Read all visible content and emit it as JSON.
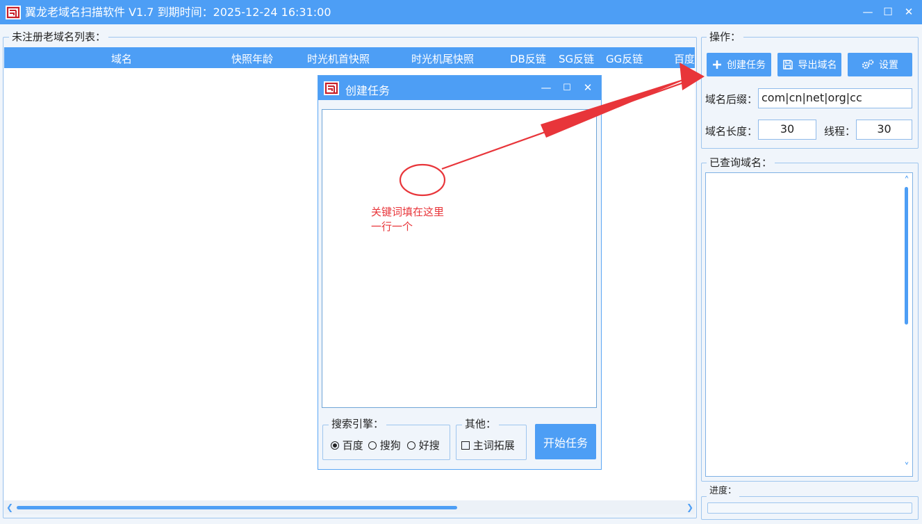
{
  "window": {
    "title": "翼龙老域名扫描软件 V1.7   到期时间：2025-12-24 16:31:00",
    "minimize": "—",
    "maximize": "☐",
    "close": "✕"
  },
  "list_group": {
    "legend": "未注册老域名列表：",
    "columns": [
      "域名",
      "快照年龄",
      "时光机首快照",
      "时光机尾快照",
      "DB反链",
      "SG反链",
      "GG反链",
      "百度"
    ],
    "rows": [],
    "scroll_left": "❮",
    "scroll_right": "❯"
  },
  "ops_group": {
    "legend": "操作：",
    "create_task": "创建任务",
    "export_domains": "导出域名",
    "settings": "设置",
    "suffix_label": "域名后缀：",
    "suffix_value": "com|cn|net|org|cc",
    "length_label": "域名长度：",
    "length_value": "30",
    "threads_label": "线程：",
    "threads_value": "30"
  },
  "queried_group": {
    "legend": "已查询域名：",
    "scroll_up": "˄",
    "scroll_down": "˅"
  },
  "progress_group": {
    "legend": "进度：",
    "progress": 0
  },
  "dialog": {
    "title": "创建任务",
    "minimize": "—",
    "maximize": "☐",
    "close": "✕",
    "keywords_text": "",
    "engine_legend": "搜索引擎：",
    "engines": [
      {
        "label": "百度",
        "selected": true
      },
      {
        "label": "搜狗",
        "selected": false
      },
      {
        "label": "好搜",
        "selected": false
      }
    ],
    "other_legend": "其他：",
    "expand_label": "主词拓展",
    "start_button": "开始任务"
  },
  "annotation": {
    "line1": "关键词填在这里",
    "line2": "一行一个",
    "color": "#e8353a"
  },
  "colors": {
    "accent": "#4d9ef5",
    "background": "#f0f5fb"
  }
}
